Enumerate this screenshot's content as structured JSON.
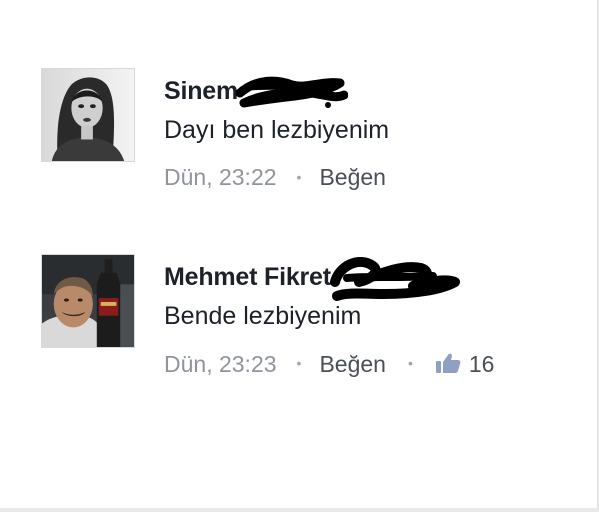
{
  "comments": [
    {
      "author": "Sinem",
      "text": "Dayı ben lezbiyenim",
      "timestamp": "Dün, 23:22",
      "like_label": "Beğen",
      "avatar_icon": "profile-photo-young-woman",
      "redaction_icon": "scribble-redaction"
    },
    {
      "author": "Mehmet Fikret",
      "text": "Bende lezbiyenim",
      "timestamp": "Dün, 23:23",
      "like_label": "Beğen",
      "like_count": "16",
      "avatar_icon": "profile-photo-man-with-bottle",
      "redaction_icon": "scribble-redaction",
      "reaction_icon": "thumbs-up-icon"
    }
  ],
  "colors": {
    "author": "#1d2129",
    "meta": "#90949c",
    "like_icon": "#5890ff",
    "redaction": "#000000"
  }
}
